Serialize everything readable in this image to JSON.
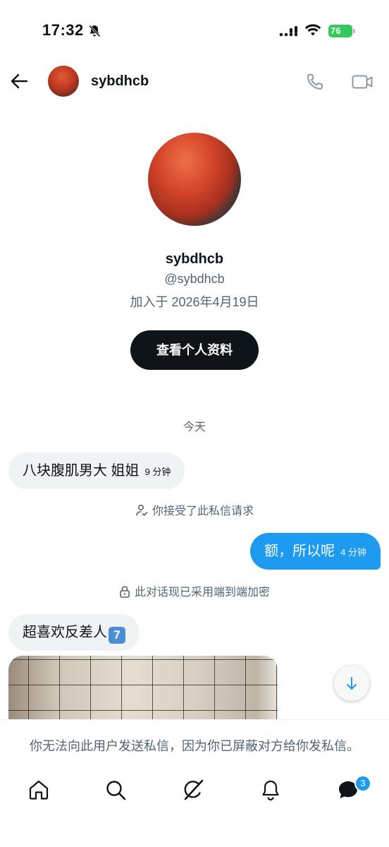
{
  "status_bar": {
    "time": "17:32",
    "battery": "76"
  },
  "header": {
    "name": "sybdhcb"
  },
  "profile": {
    "name": "sybdhcb",
    "handle": "@sybdhcb",
    "joined": "加入于 2026年4月19日",
    "view_profile_label": "查看个人资料"
  },
  "conversation": {
    "date_separator": "今天",
    "messages": [
      {
        "direction": "in",
        "text": "八块腹肌男大 姐姐",
        "time": "9 分钟"
      },
      {
        "direction": "out",
        "text": "额，所以呢",
        "time": "4 分钟"
      },
      {
        "direction": "in",
        "text": "超喜欢反差人",
        "emoji": "7"
      }
    ],
    "system_accepted": "你接受了此私信请求",
    "system_encrypted": "此对话现已采用端到端加密"
  },
  "footer": {
    "blocked_note": "你无法向此用户发送私信，因为你已屏蔽对方给你发私信。"
  },
  "bottom_nav": {
    "items": [
      "home-icon",
      "search-icon",
      "grok-icon",
      "notifications-icon",
      "messages-icon"
    ],
    "messages_badge": "3"
  },
  "colors": {
    "accent": "#1d9bf0",
    "text": "#0f1419",
    "muted": "#536471",
    "bubble_in": "#eff3f4"
  }
}
